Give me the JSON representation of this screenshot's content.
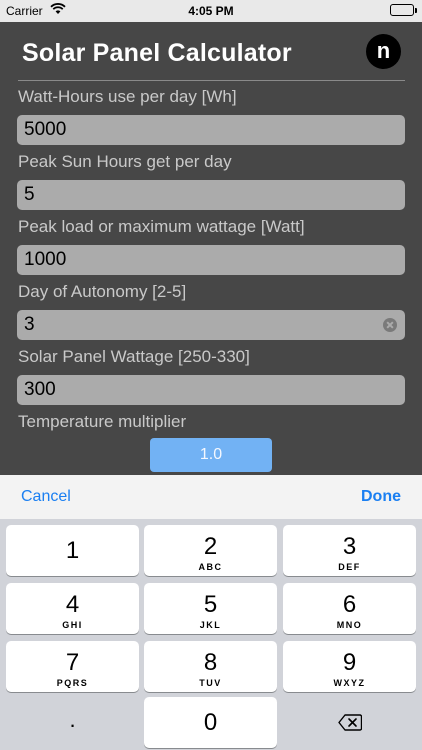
{
  "status_bar": {
    "carrier": "Carrier",
    "time": "4:05 PM",
    "icons": [
      "wifi-icon",
      "battery-icon"
    ]
  },
  "header": {
    "title": "Solar Panel Calculator",
    "logo_letter": "n"
  },
  "form": {
    "fields": [
      {
        "label": "Watt-Hours use per day [Wh]",
        "value": "5000"
      },
      {
        "label": "Peak Sun Hours get per day",
        "value": "5"
      },
      {
        "label": "Peak load or maximum wattage [Watt]",
        "value": "1000"
      },
      {
        "label": "Day of Autonomy [2-5]",
        "value": "3"
      },
      {
        "label": "Solar Panel Wattage [250-330]",
        "value": "300"
      }
    ],
    "multiplier_label": "Temperature multiplier",
    "multiplier_value": "1.0"
  },
  "keyboard": {
    "cancel_label": "Cancel",
    "done_label": "Done",
    "keys": [
      {
        "num": "1",
        "letters": ""
      },
      {
        "num": "2",
        "letters": "ABC"
      },
      {
        "num": "3",
        "letters": "DEF"
      },
      {
        "num": "4",
        "letters": "GHI"
      },
      {
        "num": "5",
        "letters": "JKL"
      },
      {
        "num": "6",
        "letters": "MNO"
      },
      {
        "num": "7",
        "letters": "PQRS"
      },
      {
        "num": "8",
        "letters": "TUV"
      },
      {
        "num": "9",
        "letters": "WXYZ"
      },
      {
        "num": ".",
        "letters": ""
      },
      {
        "num": "0",
        "letters": ""
      }
    ]
  },
  "colors": {
    "background": "#474747",
    "input": "#ababab",
    "accent_button": "#72b2f4",
    "keyboard_link": "#1a7ff2"
  }
}
